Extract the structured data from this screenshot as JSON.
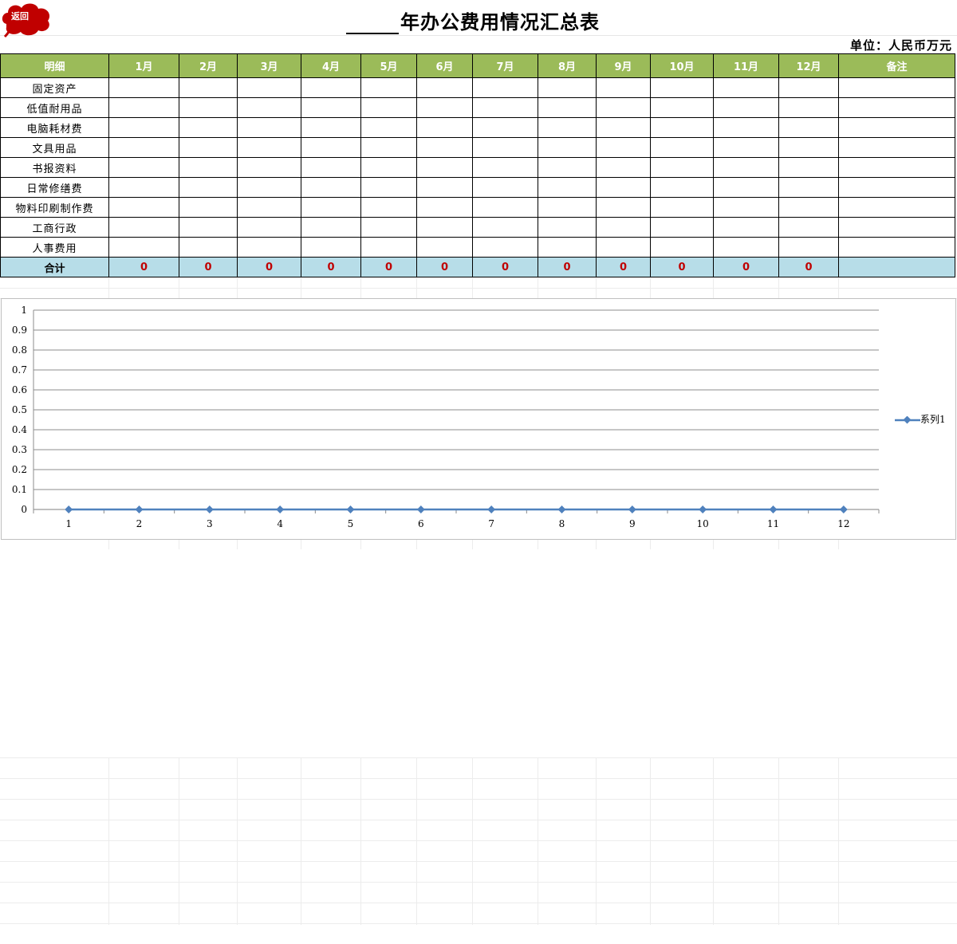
{
  "header": {
    "back_button_label": "返回",
    "title": "年办公费用情况汇总表",
    "unit": "单位：人民币万元"
  },
  "table": {
    "columns": [
      "明细",
      "1月",
      "2月",
      "3月",
      "4月",
      "5月",
      "6月",
      "7月",
      "8月",
      "9月",
      "10月",
      "11月",
      "12月",
      "备注"
    ],
    "rows": [
      "固定资产",
      "低值耐用品",
      "电脑耗材费",
      "文具用品",
      "书报资料",
      "日常修缮费",
      "物料印刷制作费",
      "工商行政",
      "人事费用"
    ],
    "total_label": "合计",
    "totals": [
      "0",
      "0",
      "0",
      "0",
      "0",
      "0",
      "0",
      "0",
      "0",
      "0",
      "0",
      "0"
    ]
  },
  "colors": {
    "header_bg": "#9bbb59",
    "total_bg": "#b7dde8",
    "total_value": "#c00000",
    "series": "#4f81bd"
  },
  "chart_data": {
    "type": "line",
    "x": [
      1,
      2,
      3,
      4,
      5,
      6,
      7,
      8,
      9,
      10,
      11,
      12
    ],
    "series": [
      {
        "name": "系列1",
        "values": [
          0,
          0,
          0,
          0,
          0,
          0,
          0,
          0,
          0,
          0,
          0,
          0
        ]
      }
    ],
    "ylim": [
      0,
      1
    ],
    "yticks": [
      "0",
      "0.1",
      "0.2",
      "0.3",
      "0.4",
      "0.5",
      "0.6",
      "0.7",
      "0.8",
      "0.9",
      "1"
    ],
    "xticks": [
      "1",
      "2",
      "3",
      "4",
      "5",
      "6",
      "7",
      "8",
      "9",
      "10",
      "11",
      "12"
    ],
    "grid": true,
    "legend": "right"
  }
}
